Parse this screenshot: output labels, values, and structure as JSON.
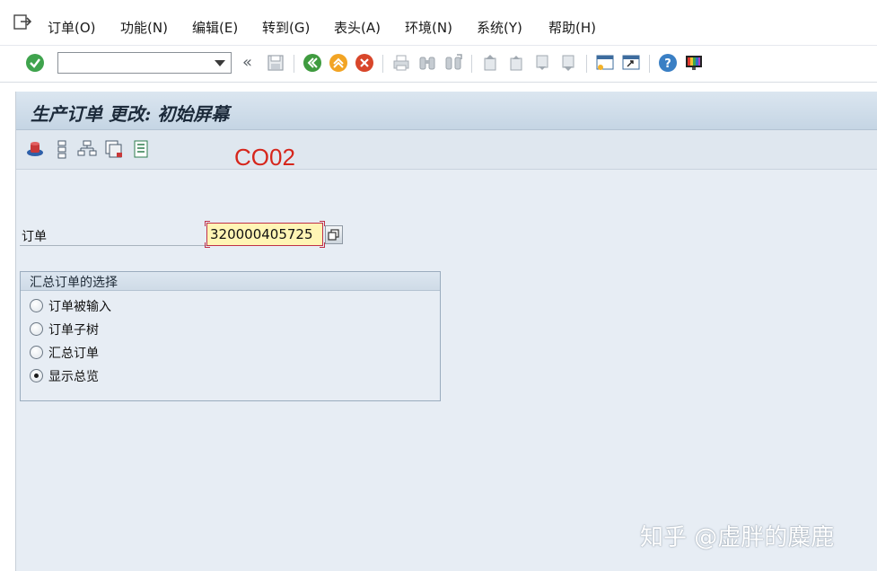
{
  "menubar": {
    "items": [
      {
        "label": "订单(O)"
      },
      {
        "label": "功能(N)"
      },
      {
        "label": "编辑(E)"
      },
      {
        "label": "转到(G)"
      },
      {
        "label": "表头(A)"
      },
      {
        "label": "环境(N)"
      },
      {
        "label": "系统(Y)"
      },
      {
        "label": "帮助(H)"
      }
    ]
  },
  "toolbar": {
    "command_field": {
      "value": "",
      "placeholder": ""
    },
    "icons": [
      "check-icon",
      "save-icon",
      "back-icon",
      "exit-icon",
      "cancel-icon",
      "print-icon",
      "find-icon",
      "find-next-icon",
      "first-page-icon",
      "previous-page-icon",
      "next-page-icon",
      "last-page-icon",
      "create-session-icon",
      "shortcut-icon",
      "help-icon",
      "customize-layout-icon"
    ]
  },
  "screen": {
    "title": "生产订单 更改: 初始屏幕",
    "annotation": "CO02",
    "app_toolbar_icons": [
      "header-icon",
      "structure-icon",
      "hierarchy-icon",
      "documents-icon",
      "list-icon"
    ]
  },
  "form": {
    "order_label": "订单",
    "order_value": "320000405725"
  },
  "collective_order_group": {
    "title": "汇总订单的选择",
    "options": [
      {
        "label": "订单被输入",
        "selected": false
      },
      {
        "label": "订单子树",
        "selected": false
      },
      {
        "label": "汇总订单",
        "selected": false
      },
      {
        "label": "显示总览",
        "selected": true
      }
    ]
  },
  "watermark": "知乎 @虚胖的麋鹿",
  "colors": {
    "annotation": "#d6261c",
    "screen_background": "#e7edf4",
    "required_field": "#fff5b5",
    "field_marker": "#c03048"
  }
}
